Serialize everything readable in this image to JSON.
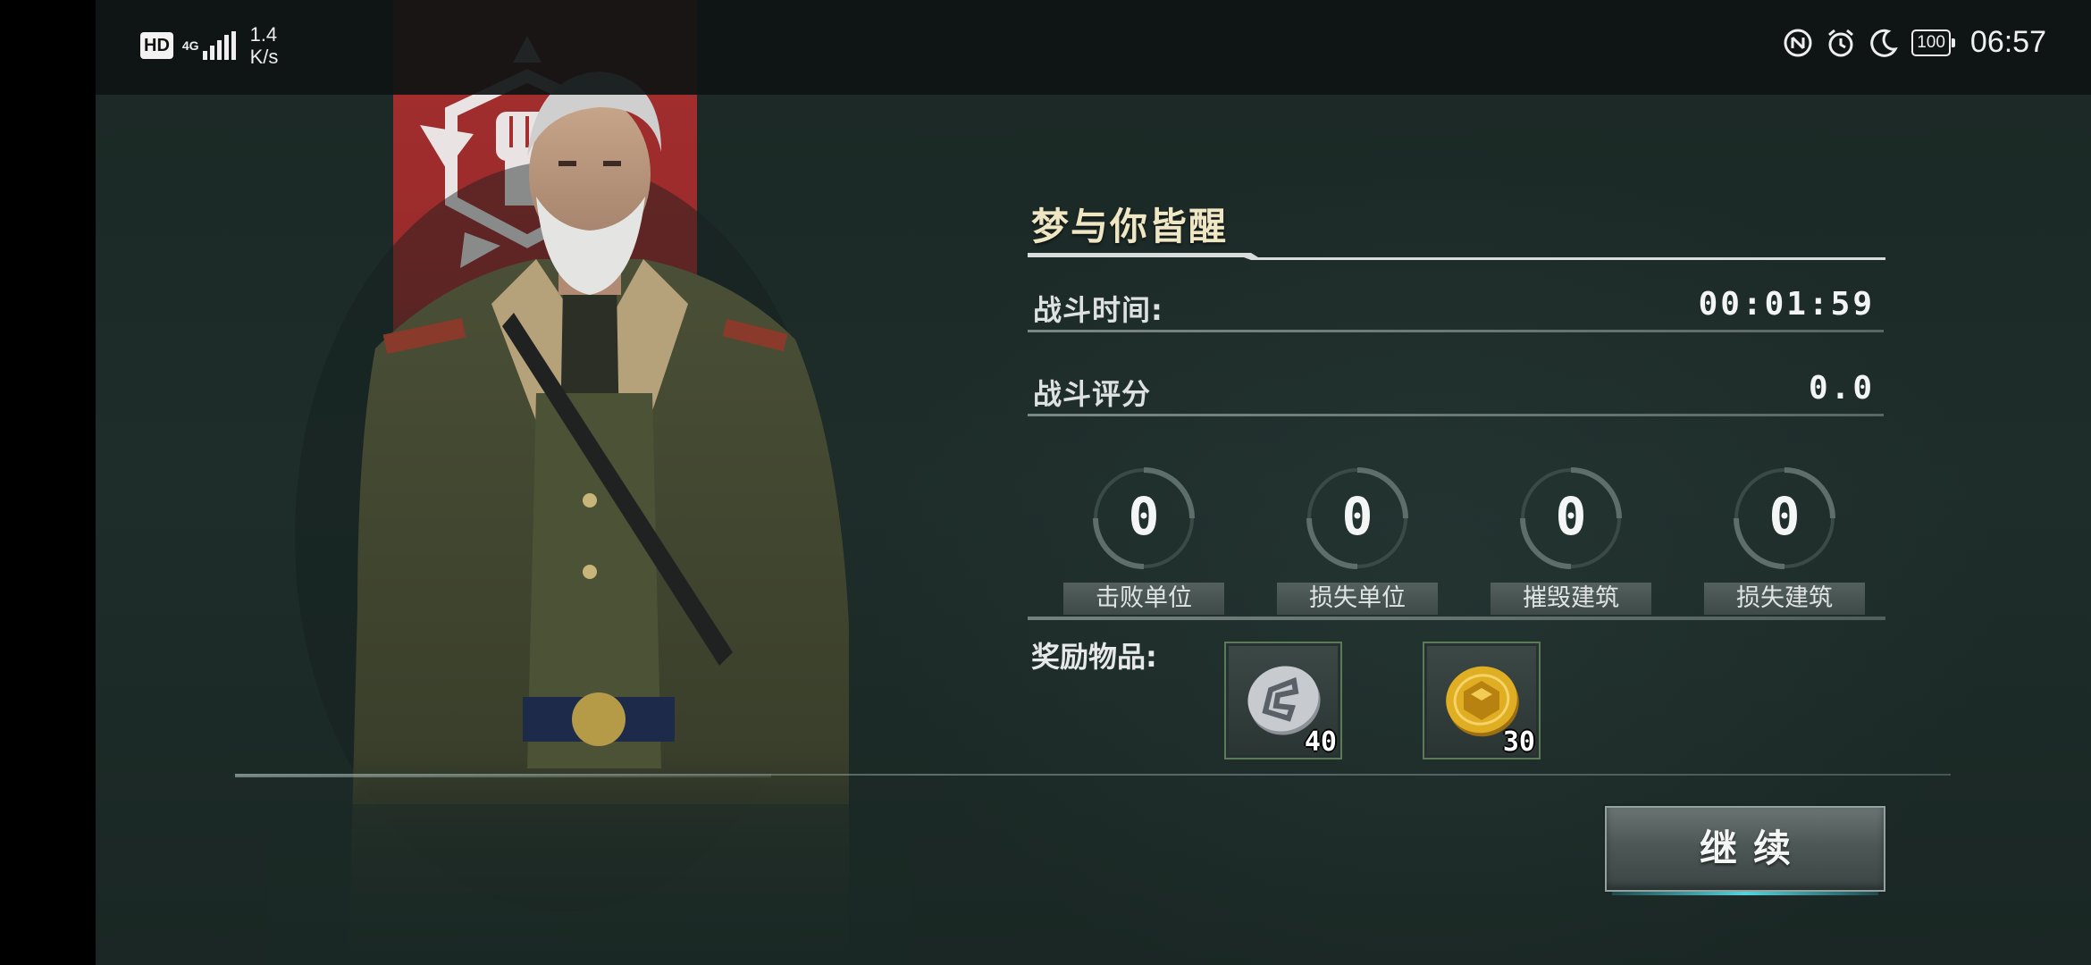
{
  "status_bar": {
    "hd_badge": "HD",
    "network_type": "4G",
    "net_speed_value": "1.4",
    "net_speed_unit": "K/s",
    "battery": "100",
    "time": "06:57",
    "icons": [
      "nfc-icon",
      "alarm-icon",
      "moon-icon",
      "battery-icon"
    ]
  },
  "result": {
    "title": "梦与你皆醒",
    "battle_time_label": "战斗时间:",
    "battle_time_value": "00:01:59",
    "battle_score_label": "战斗评分",
    "battle_score_value": "0.0",
    "counters": [
      {
        "label": "击败单位",
        "value": "0"
      },
      {
        "label": "损失单位",
        "value": "0"
      },
      {
        "label": "摧毁建筑",
        "value": "0"
      },
      {
        "label": "损失建筑",
        "value": "0"
      }
    ],
    "rewards_label": "奖励物品:",
    "rewards": [
      {
        "icon": "silver-coin-icon",
        "count": "40",
        "color": "#b9bec4"
      },
      {
        "icon": "gold-coin-icon",
        "count": "30",
        "color": "#e0ae22"
      }
    ],
    "continue_label": "继续"
  },
  "colors": {
    "background": "#1c2a27",
    "banner_red": "#a52f2f",
    "title_gold": "#efe6c3",
    "button_glow": "#5ae6f0"
  }
}
